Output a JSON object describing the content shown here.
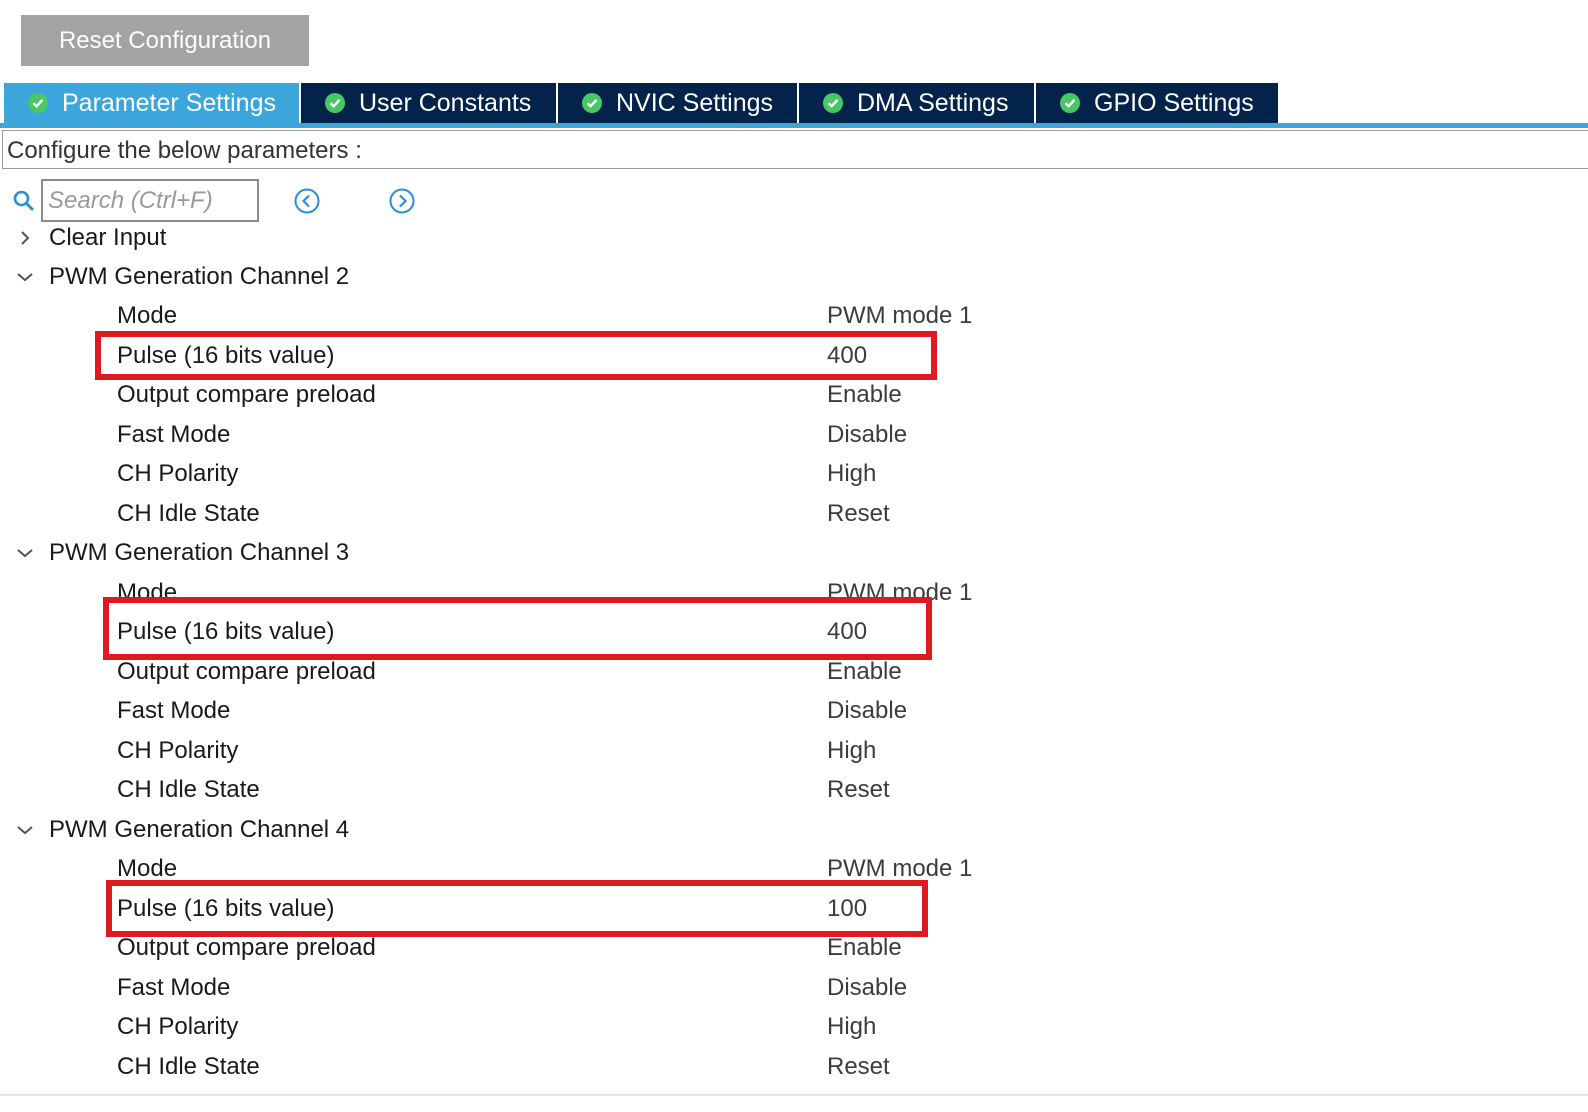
{
  "toolbar": {
    "reset_label": "Reset Configuration"
  },
  "tabs": [
    {
      "label": "Parameter Settings",
      "active": true
    },
    {
      "label": "User Constants",
      "active": false
    },
    {
      "label": "NVIC Settings",
      "active": false
    },
    {
      "label": "DMA Settings",
      "active": false
    },
    {
      "label": "GPIO Settings",
      "active": false
    }
  ],
  "configure_text": "Configure the below parameters :",
  "search": {
    "placeholder": "Search (Ctrl+F)"
  },
  "tree": {
    "clear_input": "Clear Input",
    "channels": [
      {
        "title": "PWM Generation Channel 2",
        "params": [
          {
            "name": "Mode",
            "value": "PWM mode 1"
          },
          {
            "name": "Pulse (16 bits value)",
            "value": "400"
          },
          {
            "name": "Output compare preload",
            "value": "Enable"
          },
          {
            "name": "Fast Mode",
            "value": "Disable"
          },
          {
            "name": "CH Polarity",
            "value": "High"
          },
          {
            "name": "CH Idle State",
            "value": "Reset"
          }
        ]
      },
      {
        "title": "PWM Generation Channel 3",
        "params": [
          {
            "name": "Mode",
            "value": "PWM mode 1"
          },
          {
            "name": "Pulse (16 bits value)",
            "value": "400"
          },
          {
            "name": "Output compare preload",
            "value": "Enable"
          },
          {
            "name": "Fast Mode",
            "value": "Disable"
          },
          {
            "name": "CH Polarity",
            "value": "High"
          },
          {
            "name": "CH Idle State",
            "value": "Reset"
          }
        ]
      },
      {
        "title": "PWM Generation Channel 4",
        "params": [
          {
            "name": "Mode",
            "value": "PWM mode 1"
          },
          {
            "name": "Pulse (16 bits value)",
            "value": "100"
          },
          {
            "name": "Output compare preload",
            "value": "Enable"
          },
          {
            "name": "Fast Mode",
            "value": "Disable"
          },
          {
            "name": "CH Polarity",
            "value": "High"
          },
          {
            "name": "CH Idle State",
            "value": "Reset"
          }
        ]
      }
    ]
  },
  "colors": {
    "tab_active": "#3ca5dc",
    "tab_inactive": "#03234b",
    "check_green": "#47c766",
    "highlight_red": "#e0181f",
    "reset_button": "#a3a3a3"
  }
}
